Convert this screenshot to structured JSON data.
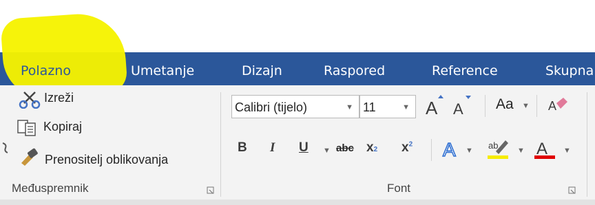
{
  "tabs": [
    "Polazno",
    "Umetanje",
    "Dizajn",
    "Raspored",
    "Reference",
    "Skupna"
  ],
  "clipboard": {
    "cut": "Izreži",
    "copy": "Kopiraj",
    "format_painter": "Prenositelj oblikovanja",
    "group_label": "Međuspremnik"
  },
  "font": {
    "font_name": "Calibri (tijelo)",
    "font_size": "11",
    "change_case": "Aa",
    "bold": "B",
    "italic": "I",
    "underline": "U",
    "strikethrough": "abc",
    "subscript": "x",
    "superscript": "x",
    "group_label": "Font"
  },
  "colors": {
    "tab_bar": "#2b579a",
    "highlight_marker": "#f6f300",
    "text_highlight": "#f6ec00",
    "font_color": "#e00000"
  }
}
